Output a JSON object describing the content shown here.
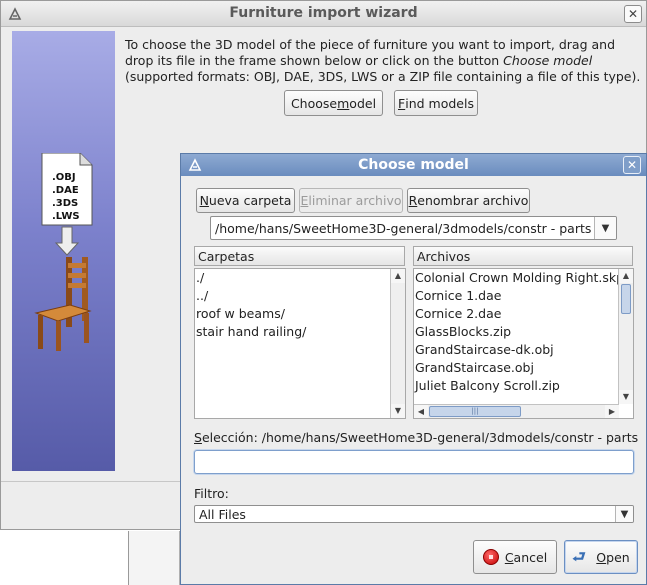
{
  "wizard": {
    "title": "Furniture import wizard",
    "instructions_part1": "To choose the 3D model of the piece of furniture you want to import, drag and drop its file in the frame shown below or click on the button ",
    "instructions_emphasis": "Choose model",
    "instructions_part2": " (supported formats: OBJ, DAE, 3DS, LWS or a ZIP file containing a file of this type).",
    "choose_model_pre": "Choose ",
    "choose_model_key": "m",
    "choose_model_post": "odel",
    "find_models_pre": "",
    "find_models_key": "F",
    "find_models_post": "ind models",
    "file_formats": [
      ".OBJ",
      ".DAE",
      ".3DS",
      ".LWS"
    ]
  },
  "dialog": {
    "title": "Choose model",
    "new_folder_pre": "",
    "new_folder_key": "N",
    "new_folder_post": "ueva carpeta",
    "delete_file_pre": "",
    "delete_file_key": "E",
    "delete_file_post": "liminar archivo",
    "rename_file_pre": "",
    "rename_file_key": "R",
    "rename_file_post": "enombrar archivo",
    "current_path": "/home/hans/SweetHome3D-general/3dmodels/constr - parts",
    "folders_header": "Carpetas",
    "files_header": "Archivos",
    "folders": [
      "./",
      "../",
      "roof w beams/",
      "stair hand railing/"
    ],
    "files": [
      "Colonial Crown Molding Right.skp",
      "Cornice 1.dae",
      "Cornice 2.dae",
      "GlassBlocks.zip",
      "GrandStaircase-dk.obj",
      "GrandStaircase.obj",
      "Juliet Balcony Scroll.zip"
    ],
    "selection_label_pre": "",
    "selection_label_key": "S",
    "selection_label_post": "elección: /home/hans/SweetHome3D-general/3dmodels/constr - parts",
    "selection_value": "",
    "filter_label": "Filtro:",
    "filter_value": "All Files",
    "cancel_pre": "",
    "cancel_key": "C",
    "cancel_post": "ancel",
    "open_pre": "",
    "open_key": "O",
    "open_post": "pen"
  }
}
